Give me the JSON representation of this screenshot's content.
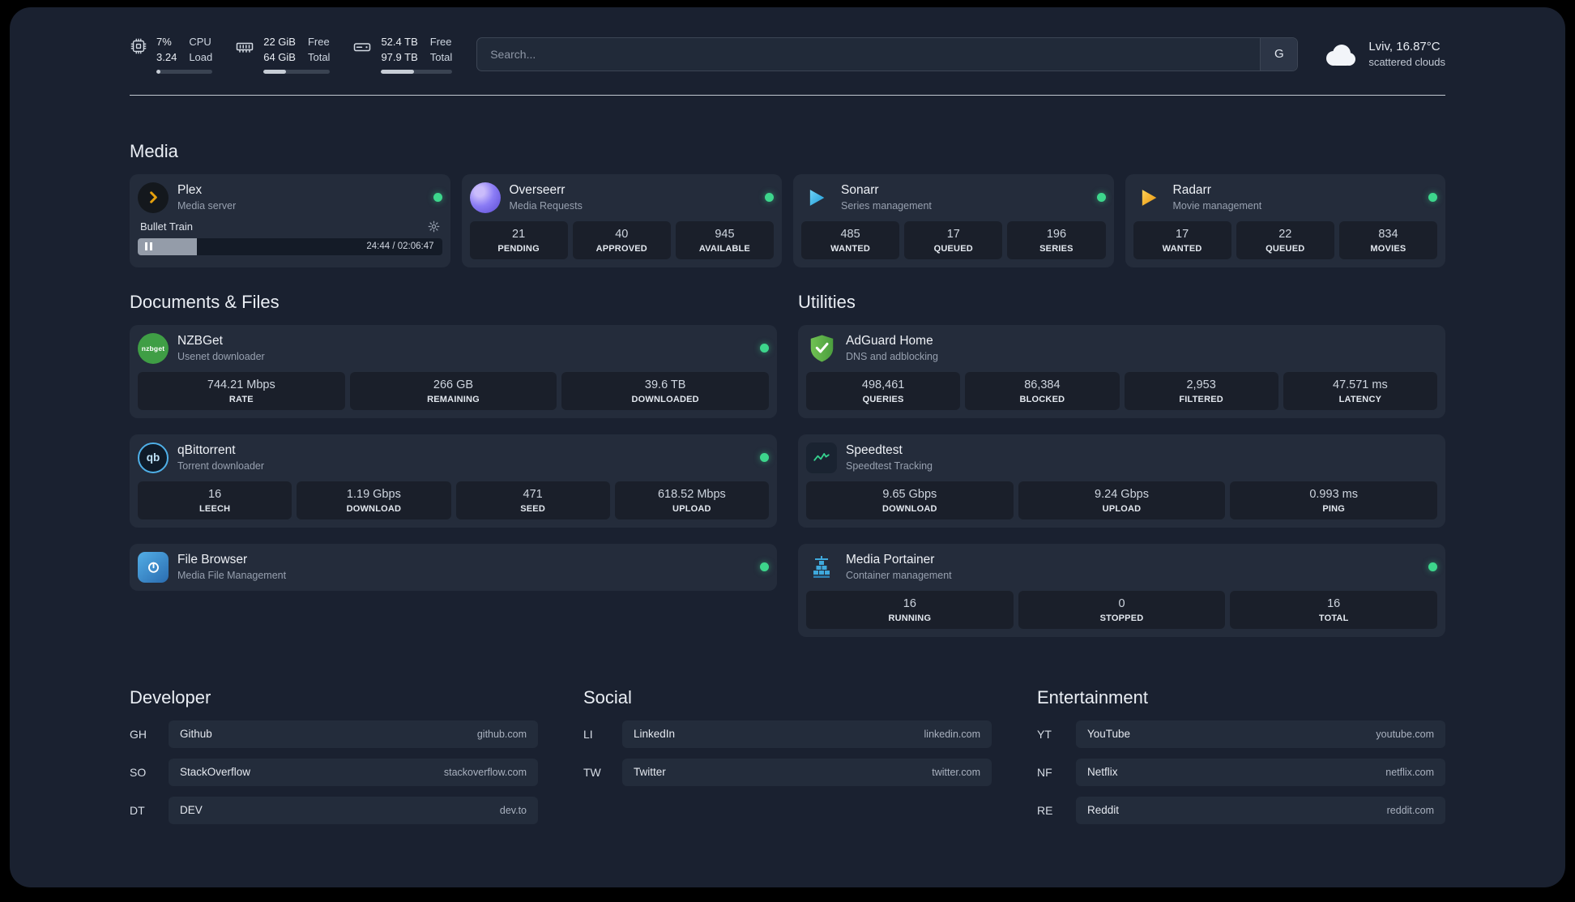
{
  "topbar": {
    "resources": [
      {
        "icon": "cpu-chip-icon",
        "values": [
          "7%",
          "3.24"
        ],
        "labels": [
          "CPU",
          "Load"
        ],
        "progress_percent": 7
      },
      {
        "icon": "memory-icon",
        "values": [
          "22 GiB",
          "64 GiB"
        ],
        "labels": [
          "Free",
          "Total"
        ],
        "progress_percent": 34
      },
      {
        "icon": "disk-icon",
        "values": [
          "52.4 TB",
          "97.9 TB"
        ],
        "labels": [
          "Free",
          "Total"
        ],
        "progress_percent": 46
      }
    ],
    "search": {
      "placeholder": "Search...",
      "engine_button_label": "G"
    },
    "weather": {
      "icon": "cloud-icon",
      "location": "Lviv, 16.87°C",
      "condition": "scattered clouds"
    }
  },
  "media": {
    "title": "Media",
    "cards": [
      {
        "icon": "plex-icon",
        "name": "Plex",
        "desc": "Media server",
        "online": true,
        "player": {
          "track": "Bullet Train",
          "settings_icon": "gear-icon",
          "pause_icon": "pause-icon",
          "time": "24:44 / 02:06:47",
          "progress_percent": 19.5
        }
      },
      {
        "icon": "overseerr-icon",
        "name": "Overseerr",
        "desc": "Media Requests",
        "online": true,
        "stats": [
          {
            "value": "21",
            "label": "PENDING"
          },
          {
            "value": "40",
            "label": "APPROVED"
          },
          {
            "value": "945",
            "label": "AVAILABLE"
          }
        ]
      },
      {
        "icon": "sonarr-icon",
        "name": "Sonarr",
        "desc": "Series management",
        "online": true,
        "stats": [
          {
            "value": "485",
            "label": "WANTED"
          },
          {
            "value": "17",
            "label": "QUEUED"
          },
          {
            "value": "196",
            "label": "SERIES"
          }
        ]
      },
      {
        "icon": "radarr-icon",
        "name": "Radarr",
        "desc": "Movie management",
        "online": true,
        "stats": [
          {
            "value": "17",
            "label": "WANTED"
          },
          {
            "value": "22",
            "label": "QUEUED"
          },
          {
            "value": "834",
            "label": "MOVIES"
          }
        ]
      }
    ]
  },
  "documents": {
    "title": "Documents & Files",
    "cards": [
      {
        "icon": "nzbget-icon",
        "icon_text": "nzbget",
        "name": "NZBGet",
        "desc": "Usenet downloader",
        "online": true,
        "stats": [
          {
            "value": "744.21 Mbps",
            "label": "RATE"
          },
          {
            "value": "266 GB",
            "label": "REMAINING"
          },
          {
            "value": "39.6 TB",
            "label": "DOWNLOADED"
          }
        ]
      },
      {
        "icon": "qbittorrent-icon",
        "icon_text": "qb",
        "name": "qBittorrent",
        "desc": "Torrent downloader",
        "online": true,
        "stats": [
          {
            "value": "16",
            "label": "LEECH"
          },
          {
            "value": "1.19 Gbps",
            "label": "DOWNLOAD"
          },
          {
            "value": "471",
            "label": "SEED"
          },
          {
            "value": "618.52 Mbps",
            "label": "UPLOAD"
          }
        ]
      },
      {
        "icon": "filebrowser-icon",
        "name": "File Browser",
        "desc": "Media File Management",
        "online": true
      }
    ]
  },
  "utilities": {
    "title": "Utilities",
    "cards": [
      {
        "icon": "adguard-icon",
        "name": "AdGuard Home",
        "desc": "DNS and adblocking",
        "online": false,
        "stats": [
          {
            "value": "498,461",
            "label": "QUERIES"
          },
          {
            "value": "86,384",
            "label": "BLOCKED"
          },
          {
            "value": "2,953",
            "label": "FILTERED"
          },
          {
            "value": "47.571 ms",
            "label": "LATENCY"
          }
        ]
      },
      {
        "icon": "speedtest-icon",
        "name": "Speedtest",
        "desc": "Speedtest Tracking",
        "online": false,
        "stats": [
          {
            "value": "9.65 Gbps",
            "label": "DOWNLOAD"
          },
          {
            "value": "9.24 Gbps",
            "label": "UPLOAD"
          },
          {
            "value": "0.993 ms",
            "label": "PING"
          }
        ]
      },
      {
        "icon": "portainer-icon",
        "name": "Media Portainer",
        "desc": "Container management",
        "online": true,
        "stats": [
          {
            "value": "16",
            "label": "RUNNING"
          },
          {
            "value": "0",
            "label": "STOPPED"
          },
          {
            "value": "16",
            "label": "TOTAL"
          }
        ]
      }
    ]
  },
  "bookmarks": [
    {
      "title": "Developer",
      "items": [
        {
          "abbr": "GH",
          "name": "Github",
          "url": "github.com"
        },
        {
          "abbr": "SO",
          "name": "StackOverflow",
          "url": "stackoverflow.com"
        },
        {
          "abbr": "DT",
          "name": "DEV",
          "url": "dev.to"
        }
      ]
    },
    {
      "title": "Social",
      "items": [
        {
          "abbr": "LI",
          "name": "LinkedIn",
          "url": "linkedin.com"
        },
        {
          "abbr": "TW",
          "name": "Twitter",
          "url": "twitter.com"
        }
      ]
    },
    {
      "title": "Entertainment",
      "items": [
        {
          "abbr": "YT",
          "name": "YouTube",
          "url": "youtube.com"
        },
        {
          "abbr": "NF",
          "name": "Netflix",
          "url": "netflix.com"
        },
        {
          "abbr": "RE",
          "name": "Reddit",
          "url": "reddit.com"
        }
      ]
    }
  ]
}
